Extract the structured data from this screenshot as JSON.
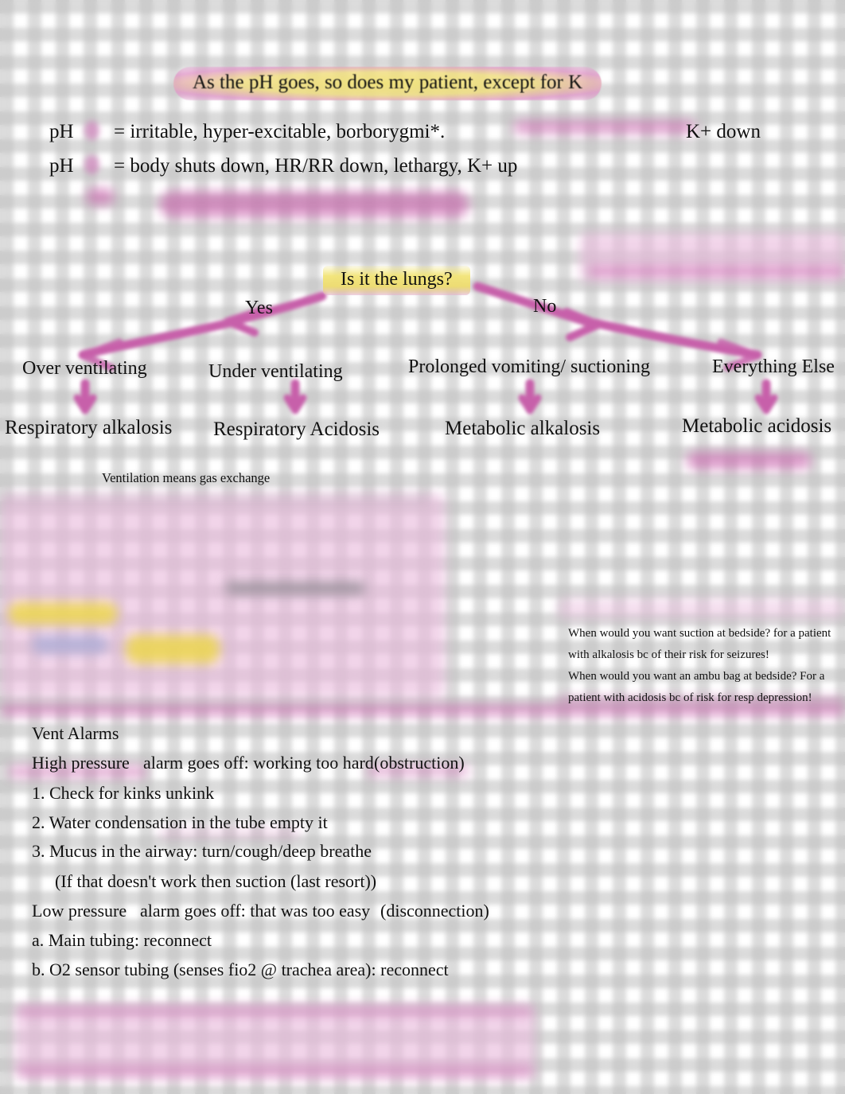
{
  "title": {
    "text": "As the pH goes, so does my patient, except for K",
    "highlight_color": "#f0e278",
    "halo_color": "#e096c8"
  },
  "ph_lines": [
    {
      "label": "pH",
      "arrow": "down-arrow",
      "text": "= irritable, hyper-excitable, borborygmi*.",
      "trailing": "K+ down"
    },
    {
      "label": "pH",
      "arrow": "up-arrow",
      "text": "= body shuts down, HR/RR down, lethargy, K+ up",
      "trailing": ""
    }
  ],
  "decision_tree": {
    "question": "Is it the lungs?",
    "question_highlight": "#f0e078",
    "branch_labels": {
      "yes": "Yes",
      "no": "No"
    },
    "causes": [
      "Over ventilating",
      "Under ventilating",
      "Prolonged vomiting/ suctioning",
      "Everything Else"
    ],
    "outcomes": [
      "Respiratory alkalosis",
      "Respiratory Acidosis",
      "Metabolic alkalosis",
      "Metabolic acidosis"
    ],
    "arrow_color": "#c760aa"
  },
  "note_ventilation": "Ventilation means gas exchange",
  "side_note": [
    "When would you want suction at bedside? for a patient",
    "with alkalosis bc of their risk for seizures!",
    "When would you want an ambu bag at bedside? For a",
    "patient with acidosis bc of risk for resp depression!"
  ],
  "vent_alarms": {
    "heading": "Vent Alarms",
    "high_pressure": {
      "label": "High pressure",
      "text": "alarm goes off: working too hard",
      "paren": "(obstruction)"
    },
    "steps": [
      "1. Check for kinks   unkink",
      "2. Water condensation in the tube   empty it",
      "3. Mucus in the airway: turn/cough/deep breathe",
      "(If that doesn't work then suction (last resort))"
    ],
    "low_pressure": {
      "label": "Low pressure",
      "text": "alarm goes off: that was too easy",
      "paren": "(disconnection)"
    },
    "low_steps": [
      "a. Main tubing: reconnect",
      "b. O2 sensor tubing (senses fio2 @ trachea area): reconnect"
    ]
  },
  "colors": {
    "pink_ink": "#c760aa",
    "pink_block": "#e8badb",
    "yellow_highlight": "#eed846",
    "grid": "#bebebe"
  }
}
